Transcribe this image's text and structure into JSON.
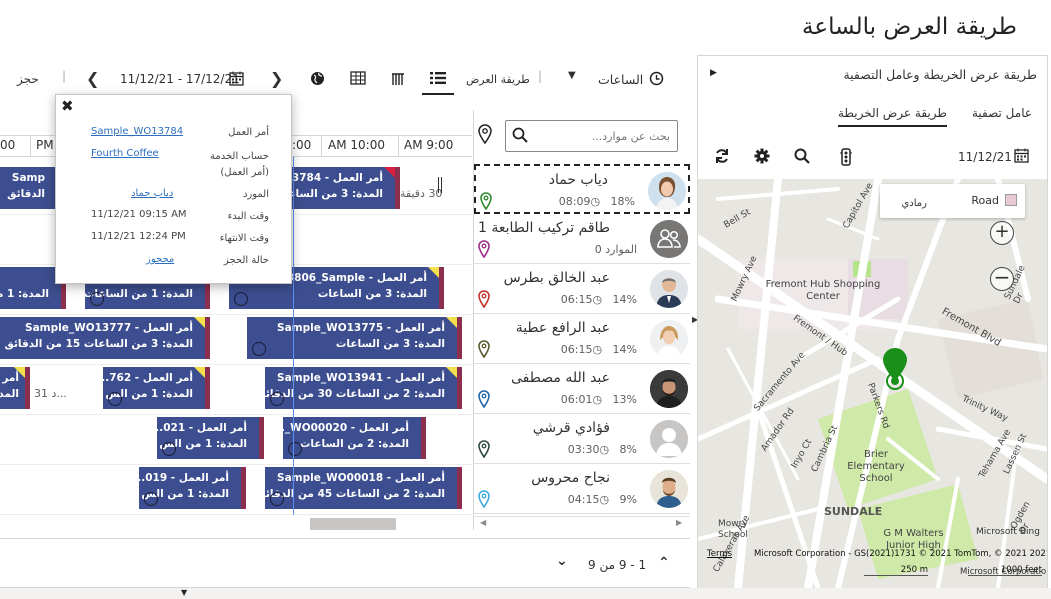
{
  "page": {
    "title": "طريقة العرض بالساعة"
  },
  "map_panel": {
    "title": "طريقة عرض الخريطة وعامل التصفية",
    "tabs": [
      {
        "label": "عامل تصفية"
      },
      {
        "label": "طريقة عرض الخريطة"
      }
    ],
    "date": "11/12/21",
    "map_type": {
      "road": "Road",
      "aerial": "رمادي"
    },
    "places": {
      "fremont_hub": "Fremont Hub Shopping Center",
      "fremont_blvd": "Fremont Blvd",
      "brier": "Brier Elementary School",
      "sundale": "SUNDALE",
      "gm_walters": "G M Walters Junior High",
      "mowry_school": "Mowry School",
      "mowry_ave": "Mowry Ave",
      "capitol_ave": "Capitol Ave",
      "bell_st": "Bell St",
      "parkers_rd": "Parkers Rd",
      "sacramento_ave": "Sacramento Ave",
      "amador_rd": "Amador Rd",
      "inyo_ct": "Inyo Ct",
      "cambria_st": "Cambria St",
      "trinity_way": "Trinity Way",
      "tehama_ave": "Tehama Ave",
      "calaveras_ave": "Calaveras Ave",
      "sundale_dr": "Sundale Dr",
      "ogden_dr": "Ogden Dr",
      "fremont_hub_rd": "Fremont / Hub",
      "lassen_st": "Lassen St"
    },
    "bing": "Microsoft Bing",
    "copyright": "Microsoft Corporation - GS(2021)1731 © 2021 TomTom, © 2021 2021 ©",
    "terms": "Terms",
    "scale_m": "250 m",
    "scale_ft": "1000 feet",
    "microsoft_corp": "Microsoft Corporation"
  },
  "toolbar": {
    "hours_label": "الساعات",
    "view_mode_label": "طريقة العرض",
    "date_range": "11/12/21 - 17/12/21",
    "book_label": "حجز"
  },
  "resources": {
    "search_placeholder": "بحث عن موارد...",
    "items": [
      {
        "name": "دياب حماد",
        "pct": "18%",
        "time": "08:09",
        "pin_color": "#2e8b2e"
      },
      {
        "name": "طاقم تركيب الطابعة 1",
        "pct": "",
        "time": "0 الموارد",
        "pin_color": "#9a2f8a"
      },
      {
        "name": "عبد الخالق بطرس",
        "pct": "14%",
        "time": "06:15",
        "pin_color": "#c0312b"
      },
      {
        "name": "عبد الرافع عطية",
        "pct": "14%",
        "time": "06:15",
        "pin_color": "#5a5a2e"
      },
      {
        "name": "عبد الله مصطفى",
        "pct": "13%",
        "time": "06:01",
        "pin_color": "#2166a8"
      },
      {
        "name": "فؤادي قرشي",
        "pct": "8%",
        "time": "03:30",
        "pin_color": "#2e4a3e"
      },
      {
        "name": "نجاح محروس",
        "pct": "9%",
        "time": "04:15",
        "pin_color": "#3fa9e0"
      }
    ]
  },
  "board": {
    "ticks": [
      {
        "label": "AM 9:00"
      },
      {
        "label": "AM 10:00"
      },
      {
        "label": ":00"
      },
      {
        "label": "PM"
      },
      {
        "label": "00"
      }
    ],
    "bookings": [
      {
        "l1": "أمر العمل - WO13784",
        "l2": "المدة: 3 من الساعات",
        "tri": "red"
      },
      {
        "l1": "Samp",
        "l2": "الدقائق",
        "tri": ""
      },
      {
        "l1": "أمر العمل - WO13806_Sample",
        "l2": "المدة: 3 من الساعات",
        "tri": "yellow"
      },
      {
        "l1": "",
        "l2": "المدة: 1 من الساعات",
        "tri": ""
      },
      {
        "l1": "",
        "l2": "المدة: 1 من",
        "tri": ""
      },
      {
        "l1": "أمر العمل - Sample_WO13775",
        "l2": "المدة: 3 من الساعات",
        "tri": "yellow"
      },
      {
        "l1": "أمر العمل - Sample_WO13777",
        "l2": "المدة: 3 من الساعات 15 من الدقائق",
        "tri": "yellow"
      },
      {
        "l1": "أمر العمل - Sample_WO13941",
        "l2": "المدة: 2 من الساعات 30 من الدقائق",
        "tri": "yellow"
      },
      {
        "l1": "أمر العمل - 762...",
        "l2": "المدة: 1 من الس",
        "tri": "yellow"
      },
      {
        "l1": "أمر",
        "l2": "المدة",
        "tri": ""
      },
      {
        "l1": "أمر العمل - WO00020_...",
        "l2": "المدة: 2 من الساعات",
        "tri": ""
      },
      {
        "l1": "أمر العمل - 021...",
        "l2": "المدة: 1 من الس",
        "tri": ""
      },
      {
        "l1": "أمر العمل - Sample_WO00018",
        "l2": "المدة: 2 من الساعات 45 من الدقائق",
        "tri": ""
      },
      {
        "l1": "أمر العمل - 019...",
        "l2": "المدة: 1 من الس",
        "tri": ""
      }
    ],
    "gap_30": "30 دقيقة",
    "gap_31": "31 د..."
  },
  "popup": {
    "rows": [
      {
        "label": "أمر العمل",
        "value": "Sample_WO13784",
        "link": true
      },
      {
        "label": "حساب الخدمة (أمر العمل)",
        "value": "Fourth Coffee",
        "link": true
      },
      {
        "label": "المورد",
        "value": "دياب حماد",
        "link": true
      },
      {
        "label": "وقت البدء",
        "value": "11/12/21 09:15 AM",
        "link": false
      },
      {
        "label": "وقت الانتهاء",
        "value": "11/12/21 12:24 PM",
        "link": false
      },
      {
        "label": "حالة الحجز",
        "value": "محجوز",
        "link": true
      }
    ]
  },
  "footer": {
    "pagination": "1 - 9 من 9"
  }
}
